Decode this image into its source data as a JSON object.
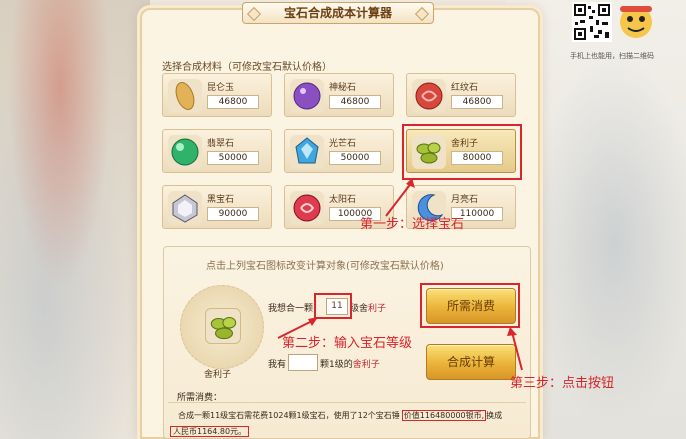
{
  "title": "宝石合成成本计算器",
  "qr_caption": "手机上也能用，扫描二维码",
  "section_label": "选择合成材料（可修改宝石默认价格）",
  "gems": [
    {
      "name": "昆仑玉",
      "price": "46800",
      "icon": "kunlun-jade-icon",
      "color": "#e2b257"
    },
    {
      "name": "神秘石",
      "price": "46800",
      "icon": "mystic-stone-icon",
      "color": "#8a4fc1"
    },
    {
      "name": "红纹石",
      "price": "46800",
      "icon": "red-vein-stone-icon",
      "color": "#d8463c"
    },
    {
      "name": "翡翠石",
      "price": "50000",
      "icon": "jade-stone-icon",
      "color": "#2fb36a"
    },
    {
      "name": "光芒石",
      "price": "50000",
      "icon": "radiance-stone-icon",
      "color": "#3fa6e0"
    },
    {
      "name": "舍利子",
      "price": "80000",
      "icon": "sarira-icon",
      "color": "#a6c33a"
    },
    {
      "name": "黑宝石",
      "price": "90000",
      "icon": "black-gem-icon",
      "color": "#c8c8d4"
    },
    {
      "name": "太阳石",
      "price": "100000",
      "icon": "sun-stone-icon",
      "color": "#e03a4e"
    },
    {
      "name": "月亮石",
      "price": "110000",
      "icon": "moon-stone-icon",
      "color": "#4a8fe0"
    }
  ],
  "calc": {
    "title": "点击上列宝石图标改变计算对象(可修改宝石默认价格)",
    "selected_name": "舍利子",
    "want_prefix": "我想合一颗",
    "level_value": "11",
    "want_suffix_1": "级舍",
    "want_suffix_2": "利子",
    "have_prefix": "我有",
    "have_value": "",
    "have_suffix": "颗1级的",
    "have_gem": "舍利子",
    "btn_cost": "所需消费",
    "btn_calc": "合成计算",
    "cost_header": "所需消费：",
    "cost_line_a": "合成一颗11级宝石需花费1024颗1级宝石，使用了12个宝石锤",
    "cost_price": "价值116480000银币,",
    "cost_tail": "换成",
    "cost_line_b": "人民币1164.80元。"
  },
  "annotations": {
    "step1": "第一步：选择宝石",
    "step2": "第二步：输入宝石等级",
    "step3": "第三步：点击按钮"
  },
  "colors": {
    "annotation": "#d8262c",
    "button": "#eab437",
    "panel": "#fbf4e3"
  }
}
